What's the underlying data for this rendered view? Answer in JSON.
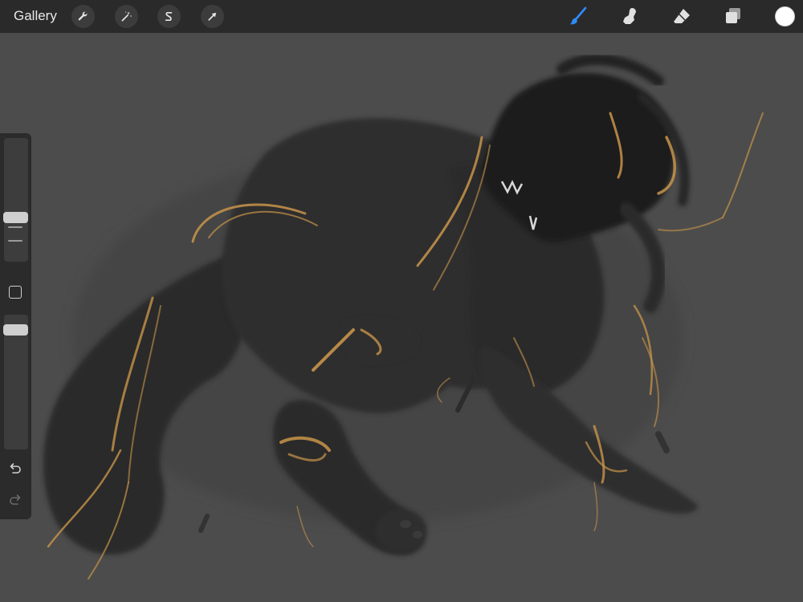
{
  "toolbar": {
    "gallery_label": "Gallery",
    "left_tools": [
      {
        "name": "actions",
        "icon": "wrench-icon"
      },
      {
        "name": "adjustments",
        "icon": "magic-wand-icon"
      },
      {
        "name": "selection",
        "icon": "selection-s-icon"
      },
      {
        "name": "transform",
        "icon": "arrow-cursor-icon"
      }
    ],
    "right_tools": [
      {
        "name": "brush",
        "icon": "brush-icon",
        "active": true
      },
      {
        "name": "smudge",
        "icon": "smudge-finger-icon",
        "active": false
      },
      {
        "name": "eraser",
        "icon": "eraser-icon",
        "active": false
      },
      {
        "name": "layers",
        "icon": "layers-icon",
        "active": false
      }
    ],
    "current_color": "#ffffff"
  },
  "sidebar": {
    "brush_size_level": 0.52,
    "brush_opacity_level": 0.95,
    "modify_button_icon": "square-icon",
    "undo_icon": "undo-arrow-icon",
    "redo_icon": "redo-arrow-icon"
  },
  "colors": {
    "toolbar_bg": "#2a2a2a",
    "canvas_bg": "#4c4c4c",
    "active_tool_blue": "#2f8cff",
    "accent_gold": "#c8944a",
    "creature_dark": "#262626"
  },
  "canvas": {
    "subject": "artwork-canvas"
  }
}
